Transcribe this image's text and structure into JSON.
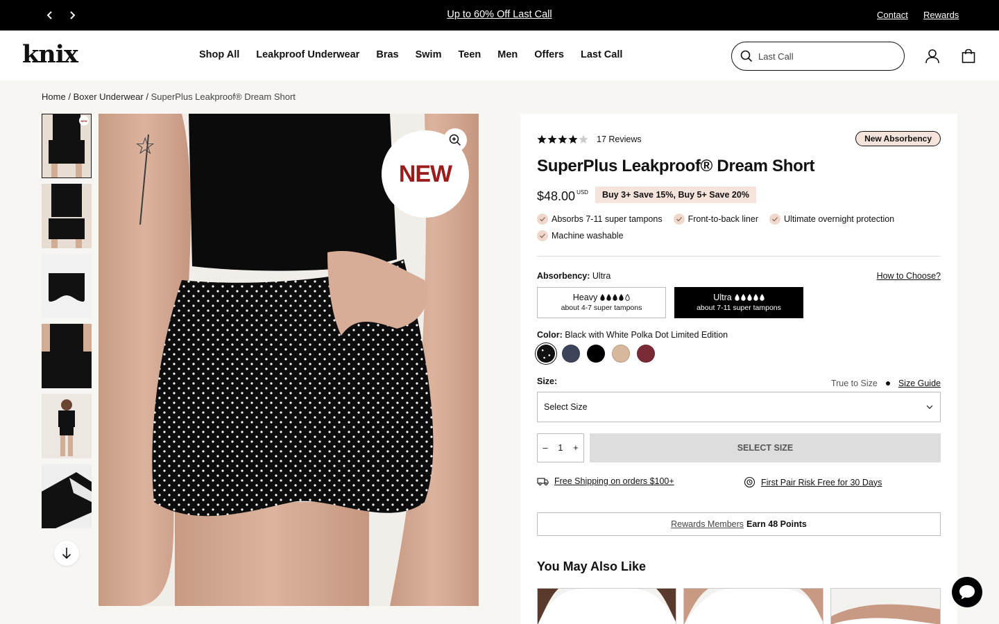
{
  "announcement": {
    "prev_icon": "chevron-left-icon",
    "next_icon": "chevron-right-icon",
    "promo": "Up to 60% Off Last Call",
    "links": [
      "Contact",
      "Rewards"
    ]
  },
  "header": {
    "logo": "knix",
    "nav": [
      "Shop All",
      "Leakproof Underwear",
      "Bras",
      "Swim",
      "Teen",
      "Men",
      "Offers",
      "Last Call"
    ],
    "search": {
      "value": "Last Call",
      "icon": "search-icon"
    },
    "icons": [
      "account-icon",
      "shopping-bag-icon"
    ]
  },
  "breadcrumb": {
    "items": [
      "Home",
      "Boxer Underwear"
    ],
    "separator": "/",
    "current": "SuperPlus Leakproof® Dream Short"
  },
  "gallery": {
    "thumbnail_count": 6,
    "active_index": 0,
    "down_icon": "arrow-down-icon",
    "badge": "NEW",
    "zoom_icon": "zoom-in-icon"
  },
  "product": {
    "rating": 4.5,
    "reviews": "17 Reviews",
    "tag": "New Absorbency",
    "title": "SuperPlus Leakproof® Dream Short",
    "price": "$48.00",
    "currency": "USD",
    "promo": "Buy 3+ Save 15%, Buy 5+ Save 20%",
    "features": [
      "Absorbs 7-11 super tampons",
      "Front-to-back liner",
      "Ultimate overnight protection",
      "Machine washable"
    ],
    "absorbency": {
      "label": "Absorbency:",
      "value": "Ultra",
      "how_link": "How to Choose?",
      "options": [
        {
          "name": "Heavy",
          "drops_filled": 4,
          "drops_total": 5,
          "desc": "about 4-7 super tampons"
        },
        {
          "name": "Ultra",
          "drops_filled": 5,
          "drops_total": 5,
          "desc": "about 7-11 super tampons"
        }
      ],
      "selected_index": 1
    },
    "color": {
      "label": "Color:",
      "value": "Black with White Polka Dot Limited Edition",
      "swatches": [
        "#111111",
        "#3d4459",
        "#000000",
        "#d8b89c",
        "#7a2a35"
      ],
      "selected_index": 0
    },
    "size": {
      "label": "Size:",
      "fit": "True to Size",
      "guide": "Size Guide",
      "placeholder": "Select Size"
    },
    "quantity": {
      "minus": "–",
      "value": "1",
      "plus": "+"
    },
    "add_button": "SELECT SIZE",
    "perks": [
      {
        "icon": "truck-icon",
        "text": "Free Shipping on orders $100+"
      },
      {
        "icon": "risk-free-icon",
        "text": "First Pair Risk Free for 30 Days"
      }
    ],
    "rewards": {
      "link": "Rewards Members",
      "points": "Earn 48 Points"
    },
    "also_like": "You May Also Like"
  },
  "chat": {
    "icon": "chat-bubble-icon"
  }
}
